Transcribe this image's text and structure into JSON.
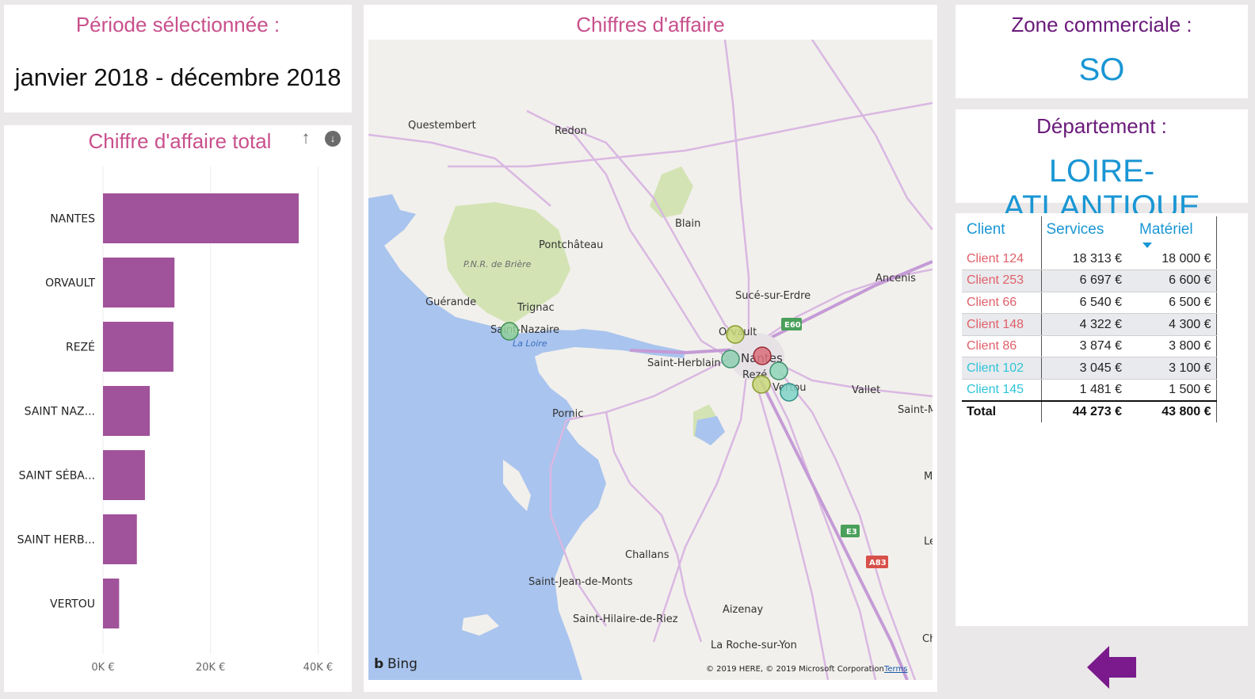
{
  "period": {
    "title": "Période sélectionnée :",
    "value": "janvier 2018 - décembre 2018"
  },
  "bar_panel": {
    "title": "Chiffre d'affaire total",
    "sort_icon": "arrow-up-icon",
    "download_icon": "arrow-down-circle-icon"
  },
  "chart_data": {
    "type": "bar",
    "orientation": "horizontal",
    "title": "Chiffre d'affaire total",
    "categories": [
      "NANTES",
      "ORVAULT",
      "REZÉ",
      "SAINT NAZ...",
      "SAINT SÉBA...",
      "SAINT HERB...",
      "VERTOU"
    ],
    "values": [
      36400,
      13300,
      13100,
      8700,
      7800,
      6300,
      3000
    ],
    "xticks": [
      "0K €",
      "20K €",
      "40K €"
    ],
    "xlim": [
      0,
      42000
    ],
    "bar_color": "#a0529a",
    "grid": true
  },
  "map": {
    "title": "Chiffres d'affaire",
    "attribution": "© 2019 HERE, © 2019 Microsoft Corporation",
    "terms": "Terms",
    "bing_label": "Bing",
    "places": [
      "Questembert",
      "Redon",
      "Blain",
      "Pontchâteau",
      "P.N.R. de Brière",
      "Guérande",
      "Trignac",
      "Saint-Nazaire",
      "La Loire",
      "Sucé-sur-Erdre",
      "Ancenis",
      "Orvault",
      "Saint-Herblain",
      "Nantes",
      "Rezé",
      "Vertou",
      "Vallet",
      "Saint-M",
      "Pornic",
      "Challans",
      "Saint-Jean-de-Monts",
      "Saint-Hilaire-de-Riez",
      "Aizenay",
      "La Roche-sur-Yon",
      "Chal",
      "Le",
      "M"
    ],
    "road_shields": [
      "E60",
      "E3",
      "A83"
    ]
  },
  "zone": {
    "title": "Zone commerciale :",
    "value": "SO"
  },
  "department": {
    "title": "Département :",
    "value": "LOIRE-ATLANTIQUE"
  },
  "table": {
    "headers": [
      "Client",
      "Services",
      "Matériel"
    ],
    "rows": [
      {
        "client": "Client 124",
        "services": "18 313 €",
        "materiel": "18 000 €",
        "color": "#e0606a"
      },
      {
        "client": "Client 253",
        "services": "6 697 €",
        "materiel": "6 600 €",
        "color": "#e0606a"
      },
      {
        "client": "Client 66",
        "services": "6 540 €",
        "materiel": "6 500 €",
        "color": "#e0606a"
      },
      {
        "client": "Client 148",
        "services": "4 322 €",
        "materiel": "4 300 €",
        "color": "#e0606a"
      },
      {
        "client": "Client 86",
        "services": "3 874 €",
        "materiel": "3 800 €",
        "color": "#e0606a"
      },
      {
        "client": "Client 102",
        "services": "3 045 €",
        "materiel": "3 100 €",
        "color": "#2ec4d8"
      },
      {
        "client": "Client 145",
        "services": "1 481 €",
        "materiel": "1 500 €",
        "color": "#2ec4d8"
      }
    ],
    "total": {
      "label": "Total",
      "services": "44 273 €",
      "materiel": "43 800 €"
    }
  },
  "back_button": {
    "icon": "back-arrow-icon",
    "color": "#7a1a8c"
  }
}
